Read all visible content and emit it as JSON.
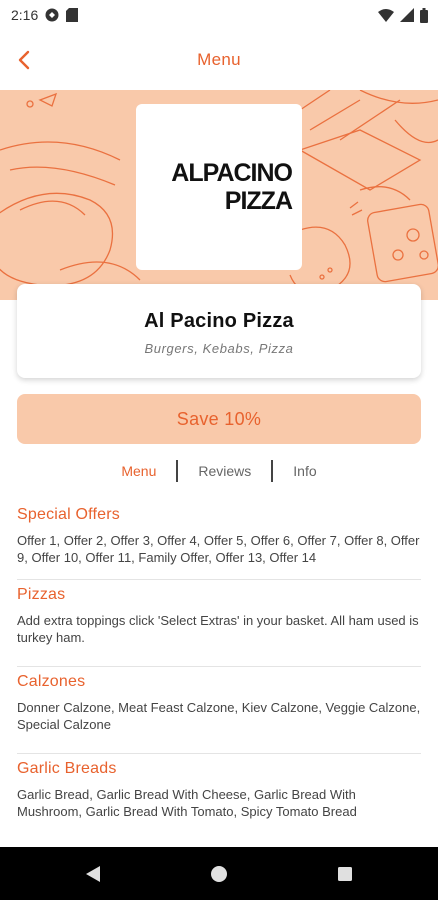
{
  "status_bar": {
    "time": "2:16"
  },
  "app_bar": {
    "title": "Menu"
  },
  "logo": {
    "line1": "ALPACINO",
    "line2": "PIZZA"
  },
  "restaurant": {
    "name": "Al Pacino Pizza",
    "cuisines": "Burgers, Kebabs, Pizza"
  },
  "offer_button": {
    "label": "Save 10%"
  },
  "tabs": [
    {
      "label": "Menu",
      "active": true
    },
    {
      "label": "Reviews",
      "active": false
    },
    {
      "label": "Info",
      "active": false
    }
  ],
  "categories": [
    {
      "title": "Special Offers",
      "description": "Offer 1, Offer 2, Offer 3, Offer 4, Offer 5, Offer 6, Offer 7, Offer 8, Offer 9, Offer 10, Offer 11, Family Offer, Offer 13, Offer 14"
    },
    {
      "title": "Pizzas",
      "description": "Add extra toppings click 'Select Extras' in your basket. All ham used is turkey ham."
    },
    {
      "title": "Calzones",
      "description": "Donner Calzone, Meat Feast Calzone, Kiev Calzone, Veggie Calzone, Special Calzone"
    },
    {
      "title": "Garlic Breads",
      "description": "Garlic Bread, Garlic Bread With Cheese, Garlic Bread With Mushroom, Garlic Bread With Tomato, Spicy Tomato Bread"
    }
  ],
  "colors": {
    "accent": "#e8622e",
    "accent_light": "#f9c9aa",
    "nav_bar": "#000000"
  },
  "icons": {
    "status_left": [
      "circle-badge-icon",
      "sim-card-icon"
    ],
    "status_right": [
      "wifi-icon",
      "signal-icon",
      "battery-icon"
    ],
    "nav": [
      "back-triangle-icon",
      "home-circle-icon",
      "recents-square-icon"
    ]
  }
}
